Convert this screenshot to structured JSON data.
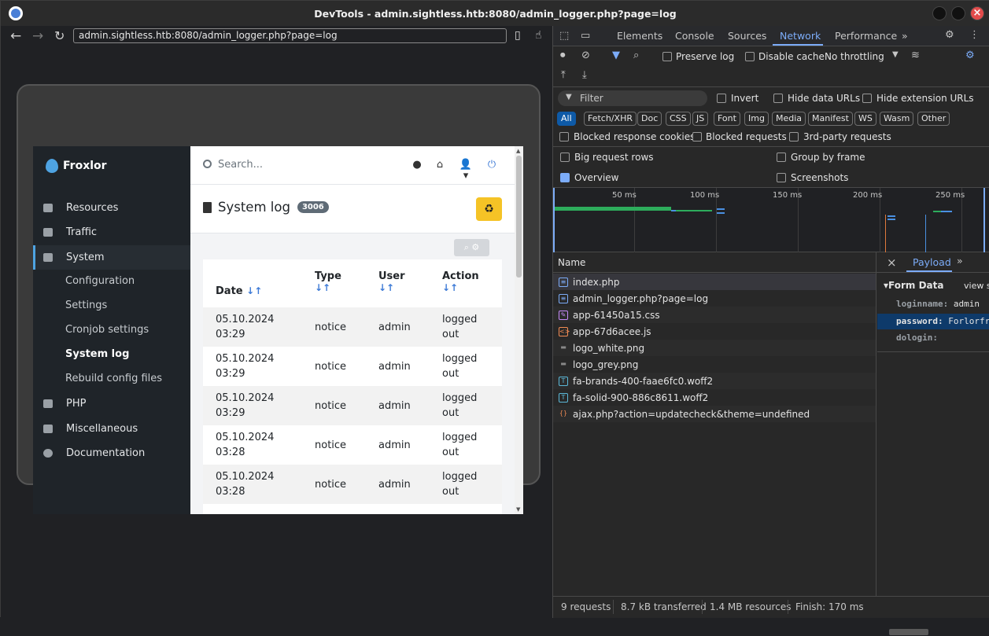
{
  "window": {
    "title": "DevTools - admin.sightless.htb:8080/admin_logger.php?page=log"
  },
  "browser": {
    "url": "admin.sightless.htb:8080/admin_logger.php?page=log"
  },
  "froxlor": {
    "brand": "Froxlor",
    "search_placeholder": "Search...",
    "nav": [
      {
        "label": "Resources",
        "icon": "resources-icon"
      },
      {
        "label": "Traffic",
        "icon": "traffic-chart-icon"
      },
      {
        "label": "System",
        "icon": "server-icon"
      },
      {
        "label": "PHP",
        "icon": "php-icon"
      },
      {
        "label": "Miscellaneous",
        "icon": "wrench-icon"
      },
      {
        "label": "Documentation",
        "icon": "info-icon"
      }
    ],
    "subnav": [
      "Configuration",
      "Settings",
      "Cronjob settings",
      "System log",
      "Rebuild config files"
    ],
    "page_title": "System log",
    "log_count": "3006",
    "columns": [
      "Date",
      "Type",
      "User",
      "Action"
    ],
    "rows": [
      {
        "date": "05.10.2024",
        "time": "03:29",
        "type": "notice",
        "user": "admin",
        "action1": "logged",
        "action2": "out"
      },
      {
        "date": "05.10.2024",
        "time": "03:29",
        "type": "notice",
        "user": "admin",
        "action1": "logged",
        "action2": "out"
      },
      {
        "date": "05.10.2024",
        "time": "03:29",
        "type": "notice",
        "user": "admin",
        "action1": "logged",
        "action2": "out"
      },
      {
        "date": "05.10.2024",
        "time": "03:28",
        "type": "notice",
        "user": "admin",
        "action1": "logged",
        "action2": "out"
      },
      {
        "date": "05.10.2024",
        "time": "03:28",
        "type": "notice",
        "user": "admin",
        "action1": "logged",
        "action2": "out"
      }
    ],
    "sort_arrows": "↓↑"
  },
  "devtools": {
    "tabs": [
      "Elements",
      "Console",
      "Sources",
      "Network",
      "Performance"
    ],
    "selected_tab": "Network",
    "toolbar": {
      "preserve_log": "Preserve log",
      "disable_cache": "Disable cache",
      "throttling": "No throttling"
    },
    "filter": {
      "placeholder": "Filter",
      "invert": "Invert",
      "hide_data_urls": "Hide data URLs",
      "hide_extension_urls": "Hide extension URLs"
    },
    "chips": [
      "All",
      "Fetch/XHR",
      "Doc",
      "CSS",
      "JS",
      "Font",
      "Img",
      "Media",
      "Manifest",
      "WS",
      "Wasm",
      "Other"
    ],
    "blocked": {
      "cookies": "Blocked response cookies",
      "requests": "Blocked requests",
      "third_party": "3rd-party requests"
    },
    "options": {
      "big_rows": "Big request rows",
      "group_by_frame": "Group by frame",
      "overview": "Overview",
      "screenshots": "Screenshots"
    },
    "timeline_labels": [
      "50 ms",
      "100 ms",
      "150 ms",
      "200 ms",
      "250 ms"
    ],
    "name_header": "Name",
    "requests": [
      {
        "name": "index.php",
        "icon": "document-icon"
      },
      {
        "name": "admin_logger.php?page=log",
        "icon": "document-icon"
      },
      {
        "name": "app-61450a15.css",
        "icon": "stylesheet-icon"
      },
      {
        "name": "app-67d6acee.js",
        "icon": "script-icon"
      },
      {
        "name": "logo_white.png",
        "icon": "image-icon"
      },
      {
        "name": "logo_grey.png",
        "icon": "image-icon"
      },
      {
        "name": "fa-brands-400-faae6fc0.woff2",
        "icon": "font-icon"
      },
      {
        "name": "fa-solid-900-886c8611.woff2",
        "icon": "font-icon"
      },
      {
        "name": "ajax.php?action=updatecheck&theme=undefined",
        "icon": "fetch-icon"
      }
    ],
    "payload": {
      "tab": "Payload",
      "section": "Form Data",
      "view_source": "view s",
      "fields": [
        {
          "key": "loginname:",
          "value": "admin"
        },
        {
          "key": "password:",
          "value": "Forlorfr"
        },
        {
          "key": "dologin:",
          "value": ""
        }
      ]
    },
    "status": {
      "requests": "9 requests",
      "transferred": "8.7 kB transferred",
      "resources": "1.4 MB resources",
      "finish": "Finish: 170 ms"
    }
  }
}
